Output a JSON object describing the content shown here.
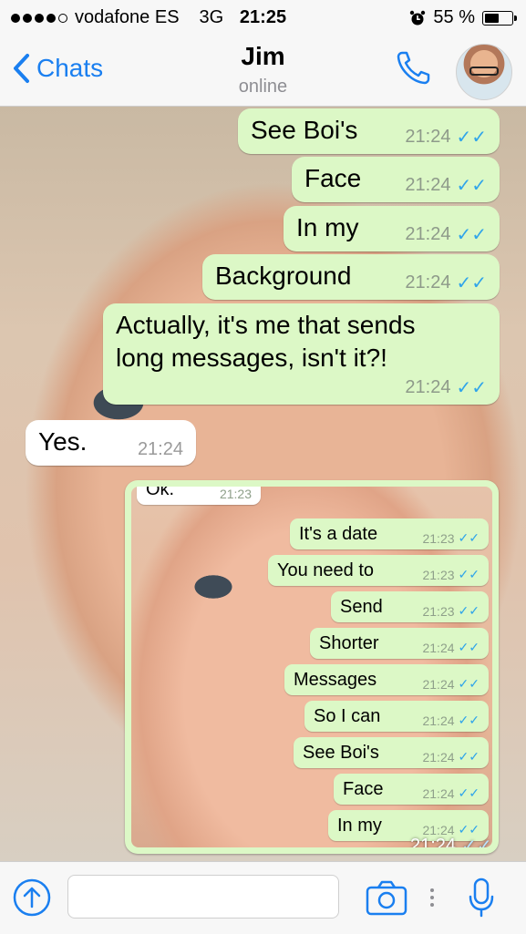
{
  "status_bar": {
    "carrier": "vodafone ES",
    "network": "3G",
    "time": "21:25",
    "battery_percent": "55 %",
    "battery_level": 0.55,
    "signal_bars": 4
  },
  "header": {
    "back_label": "Chats",
    "contact_name": "Jim",
    "contact_status": "online"
  },
  "messages": [
    {
      "text": "See Boi's",
      "time": "21:24",
      "direction": "out"
    },
    {
      "text": "Face",
      "time": "21:24",
      "direction": "out"
    },
    {
      "text": "In my",
      "time": "21:24",
      "direction": "out"
    },
    {
      "text": "Background",
      "time": "21:24",
      "direction": "out"
    },
    {
      "text": "Actually, it's me that sends\nlong messages, isn't it?!",
      "time": "21:24",
      "direction": "out"
    },
    {
      "text": "Yes.",
      "time": "21:24",
      "direction": "in"
    }
  ],
  "screenshot_message": {
    "time": "21:24",
    "inner": [
      {
        "text": "Ok.",
        "time": "21:23",
        "direction": "in"
      },
      {
        "text": "It's a date",
        "time": "21:23",
        "direction": "out"
      },
      {
        "text": "You need to",
        "time": "21:23",
        "direction": "out"
      },
      {
        "text": "Send",
        "time": "21:23",
        "direction": "out"
      },
      {
        "text": "Shorter",
        "time": "21:24",
        "direction": "out"
      },
      {
        "text": "Messages",
        "time": "21:24",
        "direction": "out"
      },
      {
        "text": "So I can",
        "time": "21:24",
        "direction": "out"
      },
      {
        "text": "See Boi's",
        "time": "21:24",
        "direction": "out"
      },
      {
        "text": "Face",
        "time": "21:24",
        "direction": "out"
      },
      {
        "text": "In my",
        "time": "21:24",
        "direction": "out"
      }
    ]
  },
  "input": {
    "placeholder": "",
    "value": ""
  },
  "colors": {
    "accent": "#1a7ff0",
    "outgoing_bubble": "#dcf8c6",
    "incoming_bubble": "#ffffff",
    "read_ticks": "#2fa4ea"
  },
  "icons": {
    "back": "chevron-left-icon",
    "call": "phone-icon",
    "attach": "upload-arrow-icon",
    "camera": "camera-icon",
    "mic": "microphone-icon",
    "alarm": "alarm-clock-icon"
  }
}
